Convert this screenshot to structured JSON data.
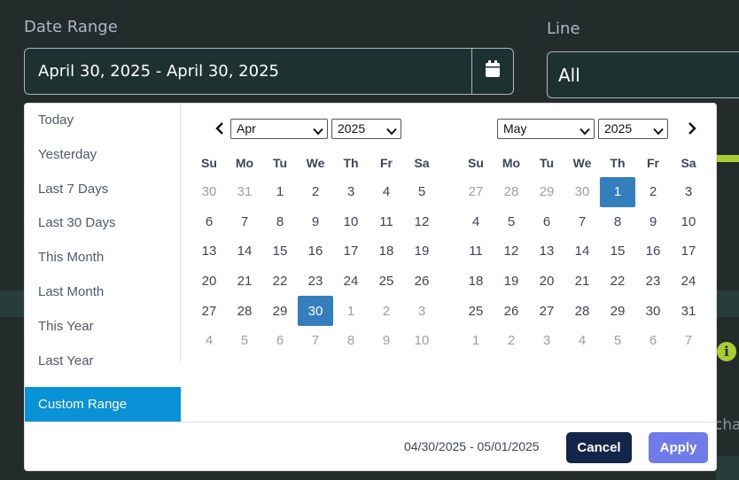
{
  "form": {
    "date_range_label": "Date Range",
    "date_range_value": "April 30, 2025 - April 30, 2025",
    "line_label": "Line",
    "line_value": "All",
    "partial_text": "char"
  },
  "picker": {
    "ranges": [
      "Today",
      "Yesterday",
      "Last 7 Days",
      "Last 30 Days",
      "This Month",
      "Last Month",
      "This Year",
      "Last Year"
    ],
    "active_range": "Custom Range",
    "weekdays": [
      "Su",
      "Mo",
      "Tu",
      "We",
      "Th",
      "Fr",
      "Sa"
    ],
    "left": {
      "month": "Apr",
      "year": "2025",
      "weeks": [
        [
          "30",
          "31",
          "1",
          "2",
          "3",
          "4",
          "5"
        ],
        [
          "6",
          "7",
          "8",
          "9",
          "10",
          "11",
          "12"
        ],
        [
          "13",
          "14",
          "15",
          "16",
          "17",
          "18",
          "19"
        ],
        [
          "20",
          "21",
          "22",
          "23",
          "24",
          "25",
          "26"
        ],
        [
          "27",
          "28",
          "29",
          "30",
          "1",
          "2",
          "3"
        ],
        [
          "4",
          "5",
          "6",
          "7",
          "8",
          "9",
          "10"
        ]
      ],
      "off": [
        [
          0,
          0
        ],
        [
          0,
          1
        ],
        [
          4,
          4
        ],
        [
          4,
          5
        ],
        [
          4,
          6
        ],
        [
          5,
          0
        ],
        [
          5,
          1
        ],
        [
          5,
          2
        ],
        [
          5,
          3
        ],
        [
          5,
          4
        ],
        [
          5,
          5
        ],
        [
          5,
          6
        ]
      ],
      "selected": [
        4,
        3
      ]
    },
    "right": {
      "month": "May",
      "year": "2025",
      "weeks": [
        [
          "27",
          "28",
          "29",
          "30",
          "1",
          "2",
          "3"
        ],
        [
          "4",
          "5",
          "6",
          "7",
          "8",
          "9",
          "10"
        ],
        [
          "11",
          "12",
          "13",
          "14",
          "15",
          "16",
          "17"
        ],
        [
          "18",
          "19",
          "20",
          "21",
          "22",
          "23",
          "24"
        ],
        [
          "25",
          "26",
          "27",
          "28",
          "29",
          "30",
          "31"
        ],
        [
          "1",
          "2",
          "3",
          "4",
          "5",
          "6",
          "7"
        ]
      ],
      "off": [
        [
          0,
          0
        ],
        [
          0,
          1
        ],
        [
          0,
          2
        ],
        [
          0,
          3
        ],
        [
          5,
          0
        ],
        [
          5,
          1
        ],
        [
          5,
          2
        ],
        [
          5,
          3
        ],
        [
          5,
          4
        ],
        [
          5,
          5
        ],
        [
          5,
          6
        ]
      ],
      "selected": [
        0,
        4
      ]
    },
    "footer_range": "04/30/2025 - 05/01/2025",
    "cancel_label": "Cancel",
    "apply_label": "Apply"
  },
  "colors": {
    "active_day": "#357ebd",
    "active_range": "#0992d5",
    "cancel": "#14254a",
    "apply": "#6f7be8"
  }
}
